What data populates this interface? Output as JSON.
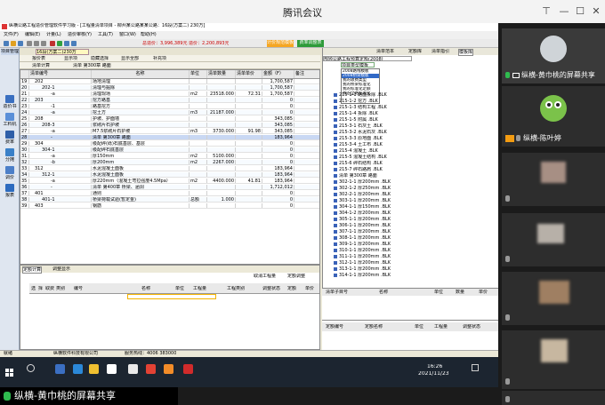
{
  "meeting": {
    "title": "腾讯会议",
    "share_label": "纵横-黄巾桃的屏幕共享"
  },
  "app": {
    "title": "纵横公路工程造价管理软件学习版 - [工程量清单项目 - 柳州某公路某某公路：16段(方案二) 230万]",
    "menu": [
      "文件(F)",
      "编辑(E)",
      "计量(L)",
      "造价审核(Y)",
      "工具(T)",
      "窗口(W)",
      "帮助(H)"
    ],
    "toolbar_totals": "总造价：3,996,389元     造价：2,200,893元",
    "toolbar_btn1": "计价规范模板",
    "toolbar_btn2": "费率调整表",
    "left_tab": "项目管理",
    "doc_tab": "16段(方案二)230万",
    "sub_tabs": [
      "报价表",
      "显示项",
      "隐藏选择",
      "显示全部",
      "补充项"
    ],
    "sub_tabs2": [
      "清单计算",
      "清单 第300章 路面"
    ],
    "nav": [
      {
        "label": "造价书"
      },
      {
        "label": "工料机"
      },
      {
        "label": "费率"
      },
      {
        "label": "分摊"
      },
      {
        "label": "调价"
      },
      {
        "label": "报表"
      }
    ],
    "grid_headers": [
      "",
      "清单编号",
      "名称",
      "单位",
      "清单数量",
      "清单单价",
      "金额（F）",
      "备注"
    ],
    "grid_rows": [
      {
        "n": "19",
        "code": "202",
        "name": "场地清理",
        "unit": "",
        "qty": "",
        "price": "",
        "amount": "1,700,587"
      },
      {
        "n": "20",
        "code": "202-1",
        "name": "清理与掘除",
        "unit": "",
        "qty": "",
        "price": "",
        "amount": "1,700,587"
      },
      {
        "n": "21",
        "code": "-a",
        "name": "清理现场",
        "unit": "m2",
        "qty": "23518.000",
        "price": "72.31",
        "amount": "1,700,587"
      },
      {
        "n": "22",
        "code": "203",
        "name": "挖方路基",
        "unit": "",
        "qty": "",
        "price": "",
        "amount": "0"
      },
      {
        "n": "23",
        "code": "-1",
        "name": "路基挖方",
        "unit": "",
        "qty": "",
        "price": "",
        "amount": "0"
      },
      {
        "n": "24",
        "code": "-a",
        "name": "挖土方",
        "unit": "m3",
        "qty": "21187.000",
        "price": "",
        "amount": "0"
      },
      {
        "n": "25",
        "code": "208",
        "name": "护坡、护面墙",
        "unit": "",
        "qty": "",
        "price": "",
        "amount": "343,085"
      },
      {
        "n": "26",
        "code": "208-3",
        "name": "浆砌片石护坡",
        "unit": "",
        "qty": "",
        "price": "",
        "amount": "343,085"
      },
      {
        "n": "27",
        "code": "-a",
        "name": "M7.5浆砌片石护坡",
        "unit": "m3",
        "qty": "3730.000",
        "price": "91.98",
        "amount": "343,085"
      },
      {
        "n": "28",
        "code": "-",
        "name": "清单 第300章 路面",
        "unit": "",
        "qty": "",
        "price": "",
        "amount": "183,964",
        "sel": true
      },
      {
        "n": "29",
        "code": "304",
        "name": "级配碎(砾)石底基层、基层",
        "unit": "",
        "qty": "",
        "price": "",
        "amount": "0"
      },
      {
        "n": "30",
        "code": "304-1",
        "name": "级配碎石底基层",
        "unit": "",
        "qty": "",
        "price": "",
        "amount": "0"
      },
      {
        "n": "31",
        "code": "-a",
        "name": "厚150mm",
        "unit": "m2",
        "qty": "5100.000",
        "price": "",
        "amount": "0"
      },
      {
        "n": "32",
        "code": "-b",
        "name": "厚200mm",
        "unit": "m2",
        "qty": "2267.000",
        "price": "",
        "amount": "0"
      },
      {
        "n": "33",
        "code": "312",
        "name": "水泥混凝土面板",
        "unit": "",
        "qty": "",
        "price": "",
        "amount": "183,964"
      },
      {
        "n": "34",
        "code": "312-1",
        "name": "水泥混凝土面板",
        "unit": "",
        "qty": "",
        "price": "",
        "amount": "183,964"
      },
      {
        "n": "35",
        "code": "-a",
        "name": "厚220mm（混凝土弯拉强度4.5Mpa）",
        "unit": "m2",
        "qty": "4400.000",
        "price": "41.81",
        "amount": "183,964"
      },
      {
        "n": "36",
        "code": "-",
        "name": "清单 第400章 桥梁、涵洞",
        "unit": "",
        "qty": "",
        "price": "",
        "amount": "1,712,012"
      },
      {
        "n": "37",
        "code": "401",
        "name": "通则",
        "unit": "",
        "qty": "",
        "price": "",
        "amount": "0"
      },
      {
        "n": "38",
        "code": "401-1",
        "name": "桥梁荷载试验(暂定金)",
        "unit": "总额",
        "qty": "1.000",
        "price": "",
        "amount": "0"
      },
      {
        "n": "39",
        "code": "403",
        "name": "钢筋",
        "unit": "",
        "qty": "",
        "price": "",
        "amount": "0"
      }
    ],
    "right_panel": {
      "head": [
        "清单范本",
        "定额库",
        "清单指引",
        "模板库"
      ],
      "combo": "部颁公路工程预算定额(2008)",
      "dropdown": [
        "项目类型模板",
        "2008路线模板",
        "2008桥梁模板",
        "我的收费类型",
        "我的桥梁标准化",
        "我的标准化定额",
        "我的全路标准化"
      ],
      "tree": [
        "215-1-1 路面拆除 .BLK",
        "215-1-2 挖方 .BLK",
        "215-1-3 结构工程 .BLK",
        "215-1-4 拆除 .BLK",
        "215-1-5 附属 .BLK",
        "215-3-1 石灰土 .BLK",
        "215-3-2 水泥石灰 .BLK",
        "215-3-3 原地面 .BLK",
        "215-3-4 土工布 .BLK",
        "215-4 混凝土 .BLK",
        "215-5 混凝土结构 .BLK",
        "215-6 碎石结构 .BLK",
        "215-7 碎石路肩 .BLK",
        "清单 第300章 路面",
        "302-1-1 厚200mm .BLK",
        "302-1-2 厚250mm .BLK",
        "302-2-1 厚200mm .BLK",
        "303-1-1 厚200mm .BLK",
        "304-1-1 厚150mm .BLK",
        "304-1-2 厚200mm .BLK",
        "305-1-1 厚200mm .BLK",
        "306-1-1 厚200mm .BLK",
        "307-1-1 厚200mm .BLK",
        "308-1-1 厚200mm .BLK",
        "309-1-1 厚200mm .BLK",
        "310-1-1 厚200mm .BLK",
        "311-1-1 厚200mm .BLK",
        "312-1-1 厚200mm .BLK",
        "313-1-1 厚200mm .BLK",
        "314-1-1 厚200mm .BLK"
      ]
    },
    "bottom_left": {
      "tabs": [
        "定额计算",
        "调整显示"
      ],
      "buttons": [
        "取消工程量",
        "定额调整"
      ],
      "headers": [
        "选",
        "择",
        "取费",
        "类别",
        "编号",
        "名称",
        "单位",
        "工程量",
        "工程类别",
        "调整状态",
        "定额",
        "单价"
      ]
    },
    "bottom_right1": {
      "headers": [
        "清单子目号",
        "名称",
        "单位",
        "数量",
        "单价"
      ]
    },
    "bottom_right2": {
      "headers": [
        "定额编号",
        "定额名称",
        "单位",
        "工程量",
        "调整状态"
      ]
    },
    "status": {
      "left": "就绪",
      "center": "纵横软件科技有限公司",
      "right": "服务热线：4006 383000"
    },
    "taskbar_time": "16:26",
    "taskbar_date": "2021/11/23"
  },
  "participants": [
    {
      "name": "纵横-黄巾桃的屏幕共享",
      "mic": "green",
      "screen": true
    },
    {
      "name": "纵横-陈叶婷",
      "mic": "gray"
    },
    {
      "name": "",
      "mic": "gray"
    },
    {
      "name": "",
      "mic": "gray"
    },
    {
      "name": "",
      "mic": "gray"
    },
    {
      "name": "",
      "mic": "gray"
    },
    {
      "name": "",
      "mic": "gray"
    }
  ]
}
